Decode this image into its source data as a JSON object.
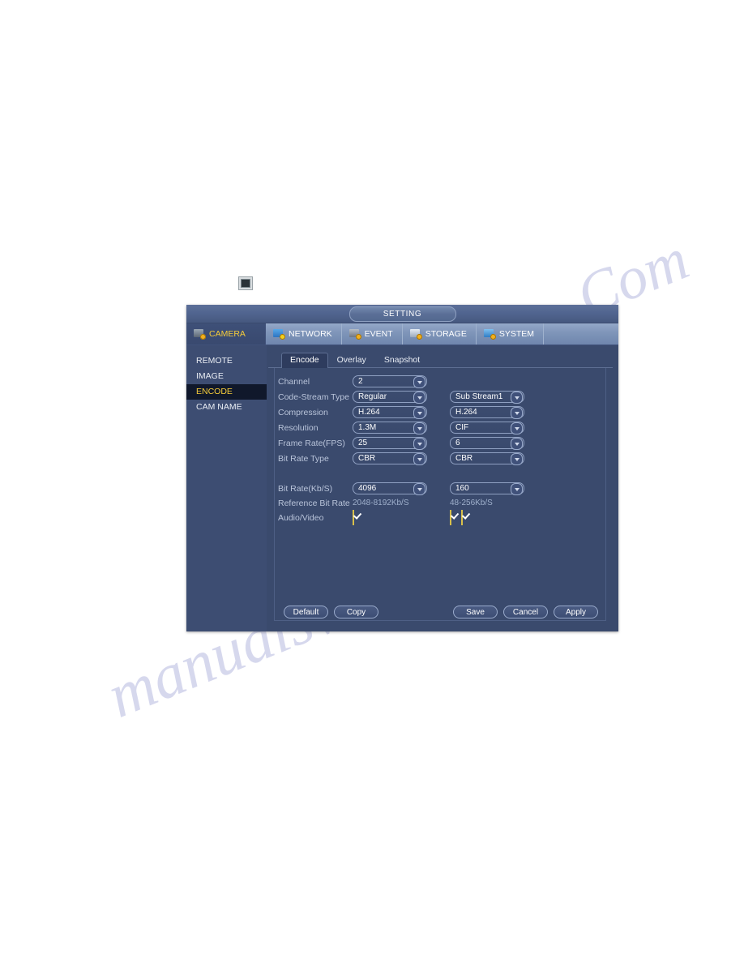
{
  "watermark": {
    "left_text": "manualsvault",
    "right_text": "Com"
  },
  "mini_icon": {
    "name": "monitor-thumbnail-icon"
  },
  "dialog": {
    "title": "SETTING",
    "top_nav": [
      {
        "label": "CAMERA",
        "icon": "camera-icon",
        "active": true
      },
      {
        "label": "NETWORK",
        "icon": "network-icon",
        "active": false
      },
      {
        "label": "EVENT",
        "icon": "event-icon",
        "active": false
      },
      {
        "label": "STORAGE",
        "icon": "storage-icon",
        "active": false
      },
      {
        "label": "SYSTEM",
        "icon": "system-icon",
        "active": false
      }
    ],
    "sidebar": [
      {
        "label": "REMOTE",
        "active": false
      },
      {
        "label": "IMAGE",
        "active": false
      },
      {
        "label": "ENCODE",
        "active": true
      },
      {
        "label": "CAM NAME",
        "active": false
      }
    ],
    "tabs": [
      {
        "label": "Encode",
        "active": true
      },
      {
        "label": "Overlay",
        "active": false
      },
      {
        "label": "Snapshot",
        "active": false
      }
    ],
    "form": {
      "channel": {
        "label": "Channel",
        "main": "2"
      },
      "code_stream_type": {
        "label": "Code-Stream Type",
        "main": "Regular",
        "sub": "Sub Stream1"
      },
      "compression": {
        "label": "Compression",
        "main": "H.264",
        "sub": "H.264"
      },
      "resolution": {
        "label": "Resolution",
        "main": "1.3M",
        "sub": "CIF"
      },
      "frame_rate": {
        "label": "Frame Rate(FPS)",
        "main": "25",
        "sub": "6"
      },
      "bit_rate_type": {
        "label": "Bit Rate Type",
        "main": "CBR",
        "sub": "CBR"
      },
      "bit_rate": {
        "label": "Bit Rate(Kb/S)",
        "main": "4096",
        "sub": "160"
      },
      "reference_bit_rate": {
        "label": "Reference Bit Rate",
        "main": "2048-8192Kb/S",
        "sub": "48-256Kb/S"
      },
      "audio_video": {
        "label": "Audio/Video",
        "main_checked": true,
        "sub_audio_checked": true,
        "sub_video_checked": true
      }
    },
    "buttons": {
      "default": "Default",
      "copy": "Copy",
      "save": "Save",
      "cancel": "Cancel",
      "apply": "Apply"
    }
  },
  "colors": {
    "accent_yellow": "#f5cc3a",
    "dialog_bg": "#3a4a6d",
    "sidebar_bg": "#3d4d72",
    "active_side": "#10182b",
    "checkbox_border": "#d8c04a"
  }
}
